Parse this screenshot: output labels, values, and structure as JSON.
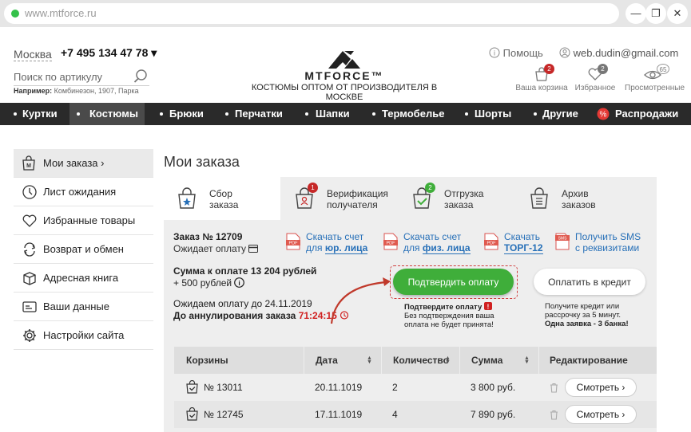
{
  "browser": {
    "url": "www.mtforce.ru",
    "win_min": "—",
    "win_max": "❐",
    "win_close": "✕"
  },
  "header": {
    "city": "Москва",
    "phone": "+7 495 134 47 78",
    "phone_caret": "▾",
    "search_placeholder": "Поиск по артикулу",
    "example_label": "Например:",
    "example_values": "Комбинезон, 1907, Парка",
    "brand": "MTFORCE™",
    "tagline": "КОСТЮМЫ ОПТОМ ОТ ПРОИЗВОДИТЕЛЯ В МОСКВЕ",
    "help": "Помощь",
    "user_email": "web.dudin@gmail.com",
    "cart_label": "Ваша корзина",
    "cart_count": "2",
    "fav_label": "Избранное",
    "fav_count": "2",
    "viewed_label": "Просмотренные",
    "viewed_count": "65"
  },
  "nav": [
    "Куртки",
    "Костюмы",
    "Брюки",
    "Перчатки",
    "Шапки",
    "Термобелье",
    "Шорты",
    "Другие",
    "Распродажи"
  ],
  "sidebar": [
    {
      "label": "Мои заказа ›",
      "icon": "order-icon"
    },
    {
      "label": "Лист ожидания",
      "icon": "clock-icon"
    },
    {
      "label": "Избранные товары",
      "icon": "heart-icon"
    },
    {
      "label": "Возврат и обмен",
      "icon": "return-icon"
    },
    {
      "label": "Адресная книга",
      "icon": "box-icon"
    },
    {
      "label": "Ваши данные",
      "icon": "card-icon"
    },
    {
      "label": "Настройки сайта",
      "icon": "gear-icon"
    }
  ],
  "page_title": "Мои заказа",
  "tabs": [
    {
      "l1": "Сбор",
      "l2": "заказа",
      "badge": ""
    },
    {
      "l1": "Верификация",
      "l2": "получателя",
      "badge": "1"
    },
    {
      "l1": "Отгрузка",
      "l2": "заказа",
      "badge": "2"
    },
    {
      "l1": "Архив",
      "l2": "заказов",
      "badge": ""
    }
  ],
  "order": {
    "number": "Заказ № 12709",
    "status": "Ожидает оплату",
    "docs": [
      {
        "l1": "Скачать счет",
        "l2a": "для ",
        "l2b": "юр. лица"
      },
      {
        "l1": "Скачать счет",
        "l2a": "для ",
        "l2b": "физ. лица"
      },
      {
        "l1": "Скачать",
        "l2a": "",
        "l2b": "ТОРГ-12"
      },
      {
        "l1": "Получить SMS",
        "l2a": "с реквизитами",
        "l2b": ""
      }
    ],
    "sum": "Сумма к оплате 13 204 рублей",
    "bonus": "+ 500 рублей",
    "until": "Ожидаем оплату до 24.11.2019",
    "cancel_label": "До аннулирования заказа",
    "timer": "71:24:15",
    "confirm_btn": "Подтвердить оплату",
    "credit_btn": "Оплатить в кредит",
    "confirm_note_title": "Подтвердите оплату",
    "confirm_note_l1": "Без подтверждения ваша",
    "confirm_note_l2": "оплата не будет принята!",
    "credit_note_l1": "Получите кредит или",
    "credit_note_l2": "рассрочку за 5 минут.",
    "credit_note_l3": "Одна заявка - 3 банка!"
  },
  "table": {
    "headers": [
      "Корзины",
      "Дата",
      "Количество",
      "Сумма",
      "Редактирование"
    ],
    "rows": [
      {
        "cart": "№ 13011",
        "date": "20.11.1019",
        "qty": "2",
        "sum": "3 800 руб.",
        "action": "Смотреть ›"
      },
      {
        "cart": "№ 12745",
        "date": "17.11.1019",
        "qty": "4",
        "sum": "7 890 руб.",
        "action": "Смотреть ›"
      }
    ]
  },
  "colors": {
    "accent_green": "#3fae3a",
    "nav_bg": "#2a2a2a",
    "link_blue": "#2770b8",
    "alert_red": "#d02020"
  }
}
